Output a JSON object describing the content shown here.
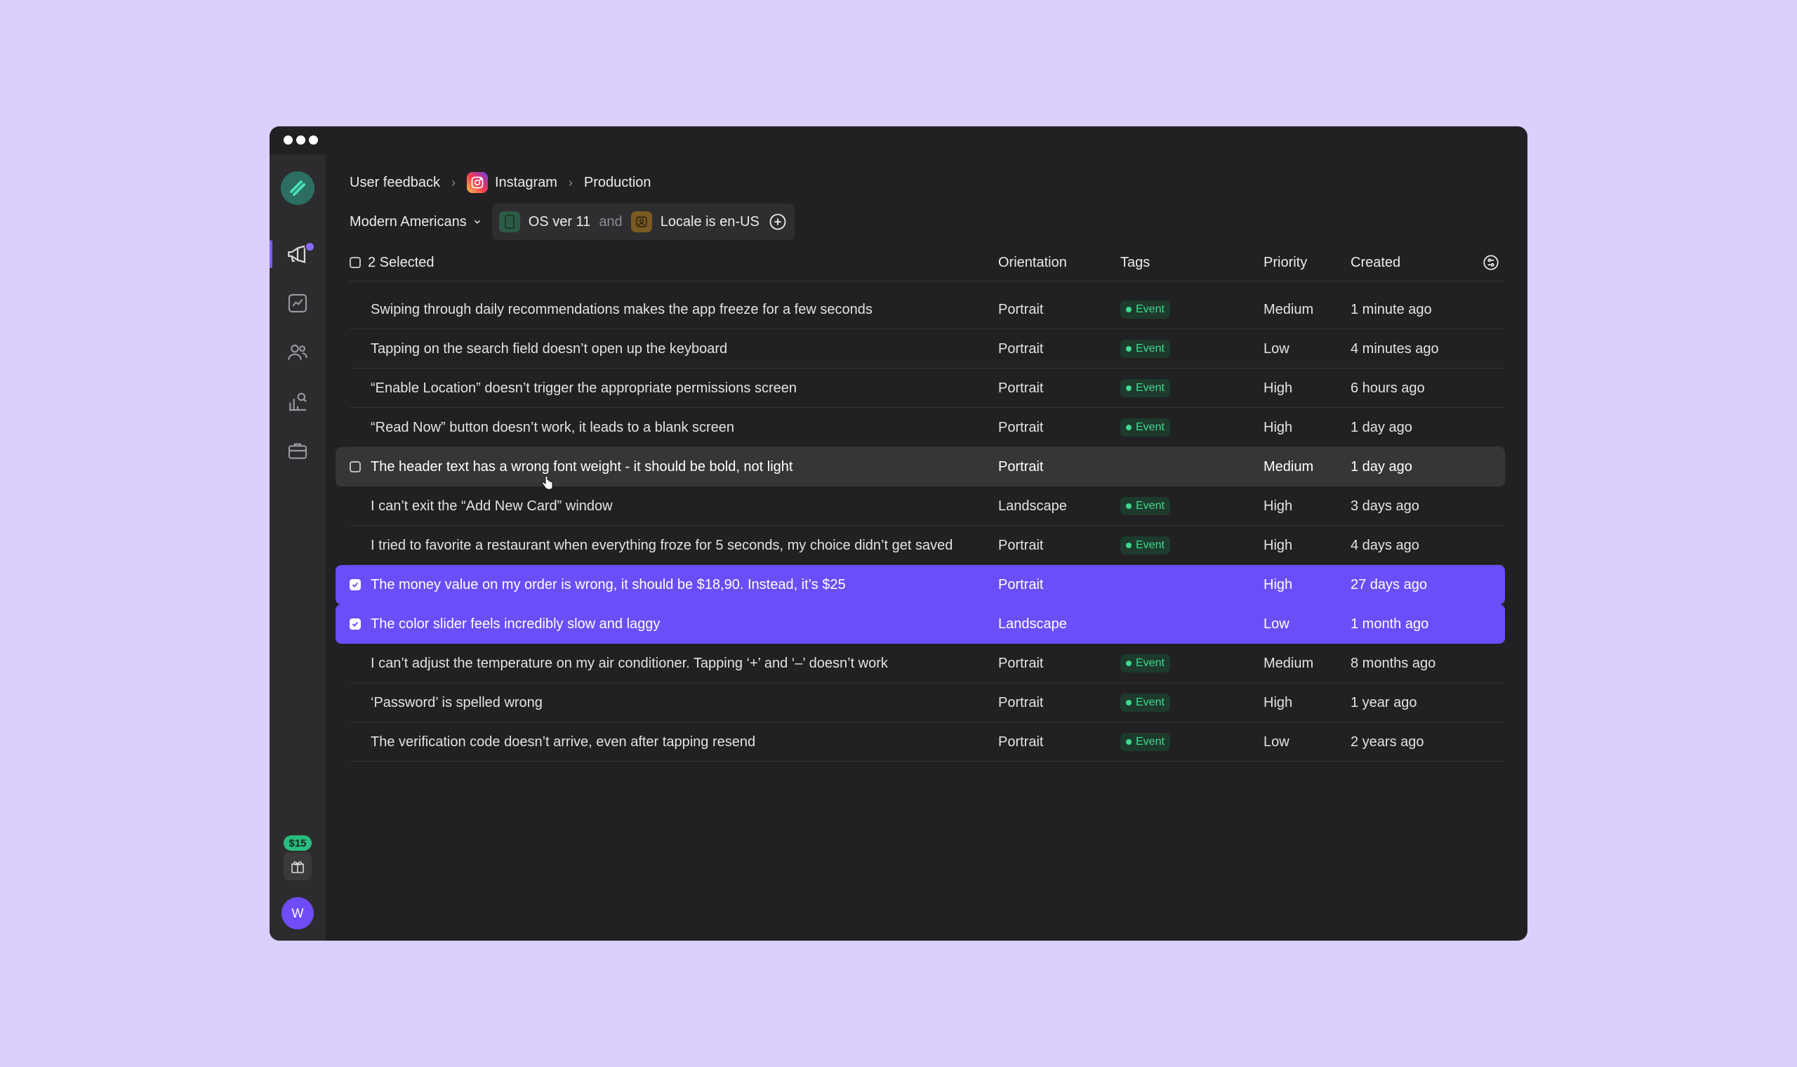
{
  "breadcrumb": {
    "items": [
      "User feedback",
      "Instagram",
      "Production"
    ]
  },
  "filters": {
    "segment": "Modern Americans",
    "conditions": [
      "OS ver 11",
      "Locale is en-US"
    ],
    "joiner": "and"
  },
  "table": {
    "selected_label": "2 Selected",
    "columns": [
      "Orientation",
      "Tags",
      "Priority",
      "Created"
    ],
    "rows": [
      {
        "title": "Swiping through daily recommendations makes the app freeze for a few seconds",
        "orientation": "Portrait",
        "tag": "Event",
        "priority": "Medium",
        "created": "1 minute ago",
        "state": ""
      },
      {
        "title": "Tapping on the search field doesn’t open up the keyboard",
        "orientation": "Portrait",
        "tag": "Event",
        "priority": "Low",
        "created": "4 minutes ago",
        "state": ""
      },
      {
        "title": "“Enable Location” doesn’t trigger the appropriate permissions screen",
        "orientation": "Portrait",
        "tag": "Event",
        "priority": "High",
        "created": "6 hours ago",
        "state": ""
      },
      {
        "title": "“Read Now” button doesn’t work, it leads to a blank screen",
        "orientation": "Portrait",
        "tag": "Event",
        "priority": "High",
        "created": "1 day ago",
        "state": ""
      },
      {
        "title": "The header text has a wrong font weight - it should be bold, not light",
        "orientation": "Portrait",
        "tag": "",
        "priority": "Medium",
        "created": "1 day ago",
        "state": "hover"
      },
      {
        "title": "I can’t exit the “Add New Card” window",
        "orientation": "Landscape",
        "tag": "Event",
        "priority": "High",
        "created": "3 days ago",
        "state": ""
      },
      {
        "title": "I tried to favorite a restaurant when everything froze for 5 seconds, my choice didn’t get saved",
        "orientation": "Portrait",
        "tag": "Event",
        "priority": "High",
        "created": "4 days ago",
        "state": ""
      },
      {
        "title": "The money value on my order is wrong, it should be $18,90. Instead, it’s $25",
        "orientation": "Portrait",
        "tag": "",
        "priority": "High",
        "created": "27 days ago",
        "state": "selected"
      },
      {
        "title": "The color slider feels incredibly slow and laggy",
        "orientation": "Landscape",
        "tag": "",
        "priority": "Low",
        "created": "1 month ago",
        "state": "selected"
      },
      {
        "title": "I can’t adjust the temperature on my air conditioner. Tapping ‘+’ and ‘–’ doesn’t work",
        "orientation": "Portrait",
        "tag": "Event",
        "priority": "Medium",
        "created": "8 months ago",
        "state": ""
      },
      {
        "title": "‘Password’ is spelled wrong",
        "orientation": "Portrait",
        "tag": "Event",
        "priority": "High",
        "created": "1 year ago",
        "state": ""
      },
      {
        "title": "The verification code doesn’t arrive, even after tapping resend",
        "orientation": "Portrait",
        "tag": "Event",
        "priority": "Low",
        "created": "2 years ago",
        "state": ""
      }
    ]
  },
  "sidebar": {
    "gift_badge": "$15",
    "avatar_initial": "W",
    "icons": [
      "megaphone-icon",
      "chart-icon",
      "users-icon",
      "search-report-icon",
      "briefcase-icon"
    ]
  },
  "colors": {
    "background": "#dacffd",
    "window": "#212123",
    "accent": "#6a4ef7",
    "tag_green": "#40d98f"
  }
}
